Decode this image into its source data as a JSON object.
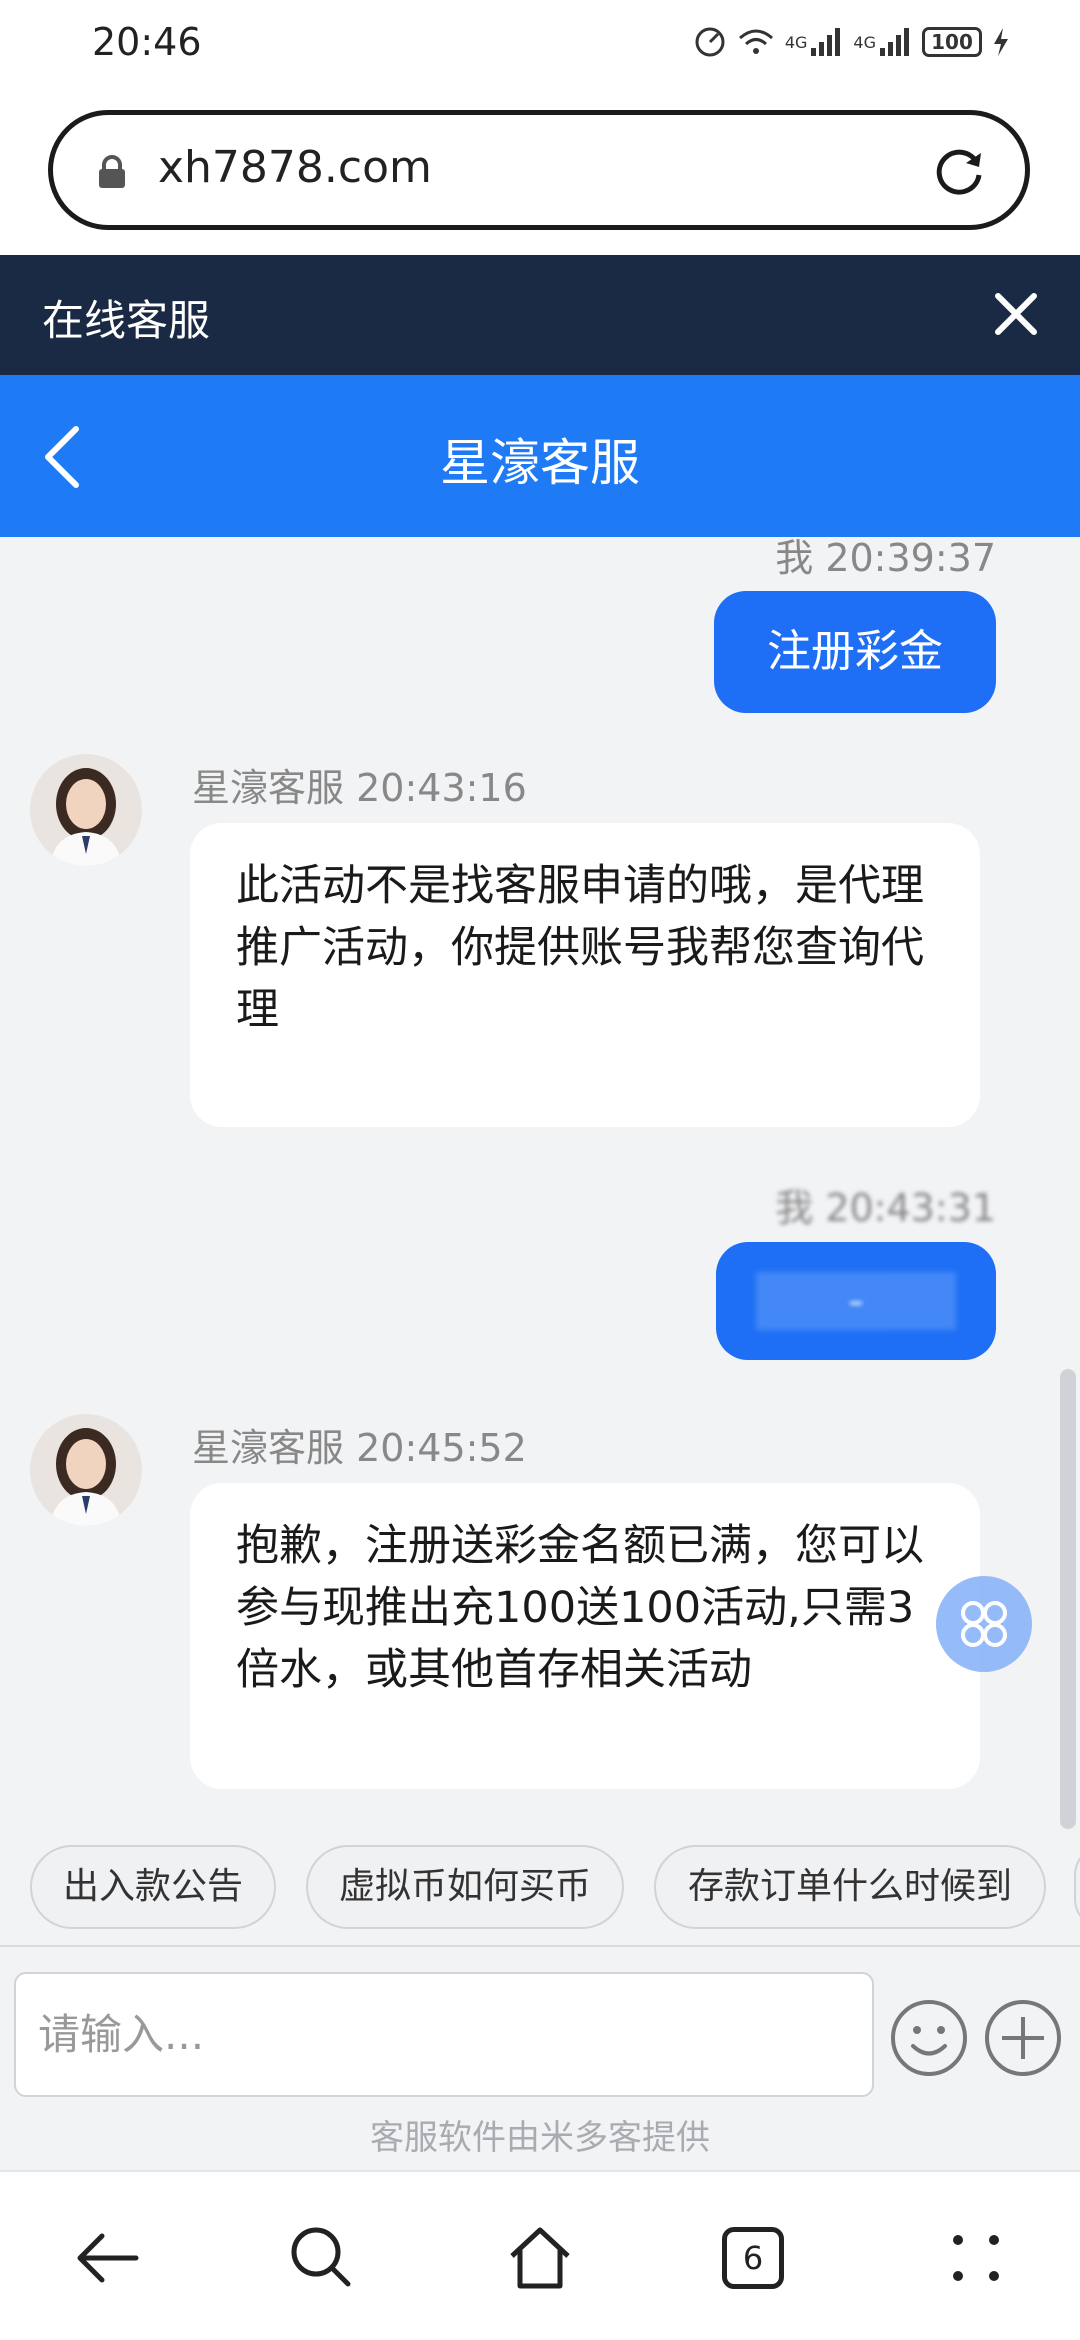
{
  "status_bar": {
    "time": "20:46",
    "battery": "100",
    "network_1": "4G",
    "network_2": "4G"
  },
  "browser": {
    "url": "xh7878.com",
    "tab_count": "6"
  },
  "cs_header": {
    "title": "在线客服"
  },
  "chat_header": {
    "title": "星濠客服"
  },
  "messages": [
    {
      "sender": "我",
      "time": "20:39:37",
      "text": "注册彩金"
    },
    {
      "sender": "星濠客服",
      "time": "20:43:16",
      "text": "此活动不是找客服申请的哦，是代理推广活动，你提供账号我帮您查询代理"
    },
    {
      "sender": "我",
      "time": "20:43:31",
      "text": "-"
    },
    {
      "sender": "星濠客服",
      "time": "20:45:52",
      "text": "抱歉，注册送彩金名额已满，您可以参与现推出充100送100活动,只需3倍水，或其他首存相关活动"
    }
  ],
  "quick_replies": [
    "出入款公告",
    "虚拟币如何买币",
    "存款订单什么时候到"
  ],
  "input": {
    "placeholder": "请输入..."
  },
  "powered_by": "客服软件由米多客提供",
  "colors": {
    "accent": "#1e7bf5",
    "header_dark": "#1b2a44",
    "bubble_me": "#1e6ff5"
  }
}
